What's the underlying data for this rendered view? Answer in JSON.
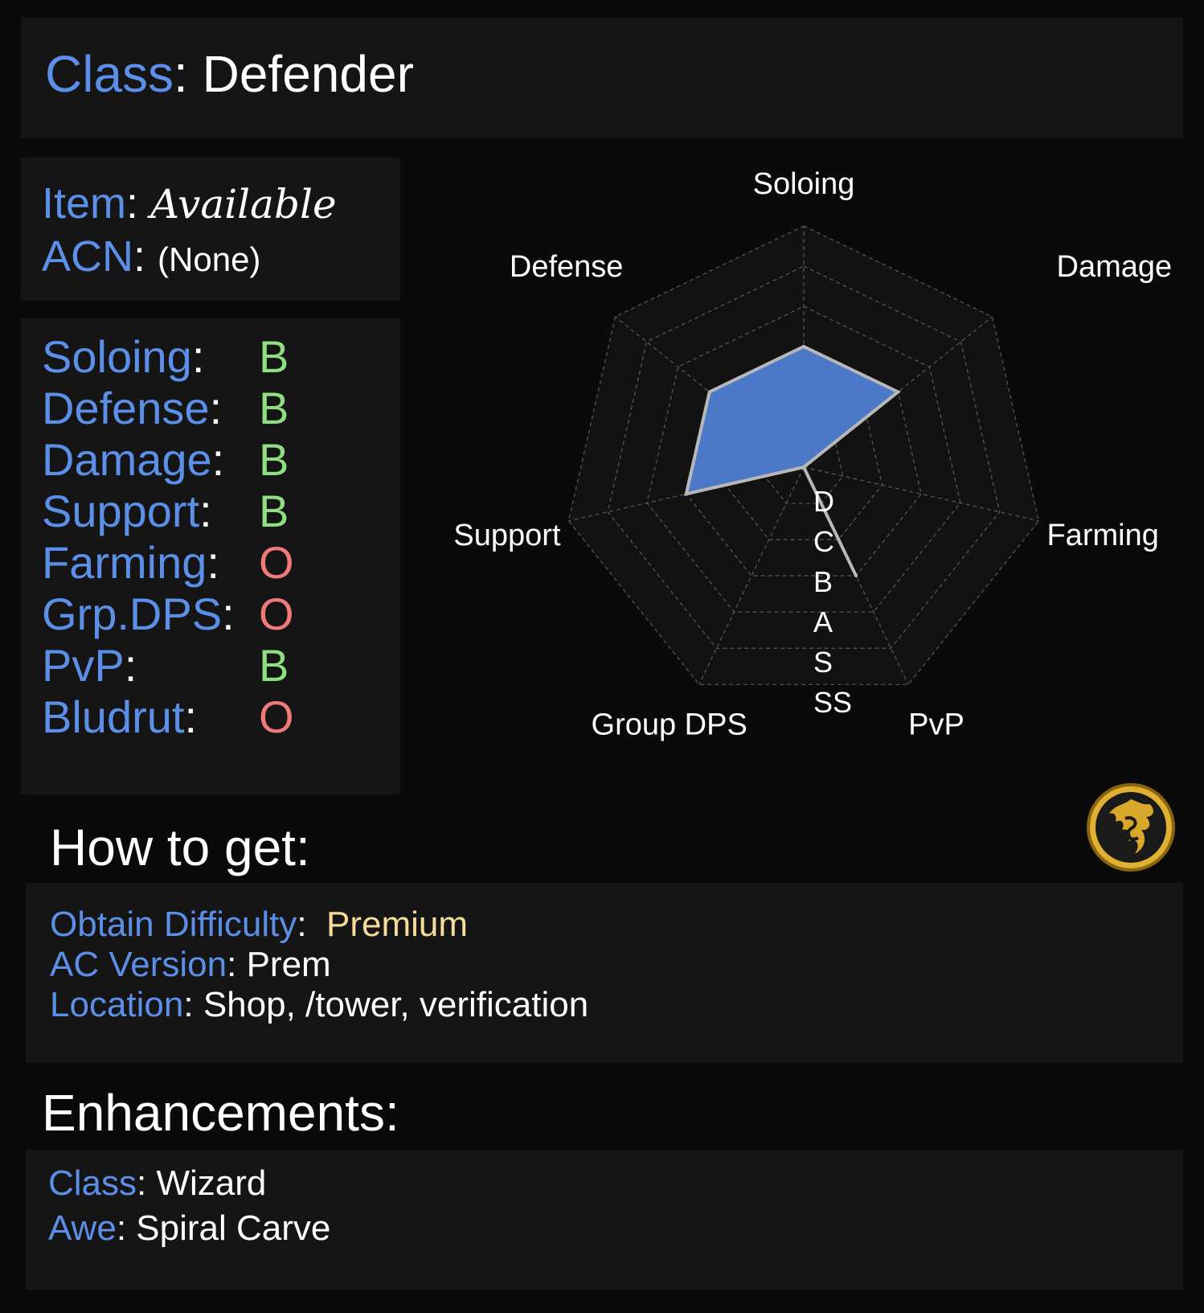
{
  "header": {
    "class_label": "Class",
    "class_value": "Defender"
  },
  "item": {
    "item_label": "Item",
    "item_value": "Available",
    "acn_label": "ACN",
    "acn_value": "(None)"
  },
  "grades": [
    {
      "label": "Soloing",
      "grade": "B",
      "status": "good"
    },
    {
      "label": "Defense",
      "grade": "B",
      "status": "good"
    },
    {
      "label": "Damage",
      "grade": "B",
      "status": "good"
    },
    {
      "label": "Support",
      "grade": "B",
      "status": "good"
    },
    {
      "label": "Farming",
      "grade": "O",
      "status": "bad"
    },
    {
      "label": "Grp.DPS",
      "grade": "O",
      "status": "bad"
    },
    {
      "label": "PvP",
      "grade": "B",
      "status": "good"
    },
    {
      "label": "Bludrut",
      "grade": "O",
      "status": "bad"
    }
  ],
  "chart_data": {
    "type": "radar",
    "axes": [
      "Soloing",
      "Damage",
      "Farming",
      "PvP",
      "Group DPS",
      "Support",
      "Defense"
    ],
    "scale_labels": [
      "D",
      "C",
      "B",
      "A",
      "S",
      "SS"
    ],
    "values": [
      3,
      3,
      0,
      3,
      0,
      3,
      3
    ],
    "max": 6,
    "fill_color": "#4f7fd2",
    "outline_color": "#b8b8b8",
    "grid": true
  },
  "how_to_get": {
    "title": "How to get:",
    "difficulty_label": "Obtain Difficulty",
    "difficulty_value": "Premium",
    "version_label": "AC Version",
    "version_value": "Prem",
    "location_label": "Location",
    "location_value": "Shop, /tower, verification"
  },
  "enhancements": {
    "title": "Enhancements:",
    "class_label": "Class",
    "class_value": "Wizard",
    "awe_label": "Awe",
    "awe_value": "Spiral Carve"
  },
  "logo": {
    "icon": "dragon-emblem-icon"
  }
}
